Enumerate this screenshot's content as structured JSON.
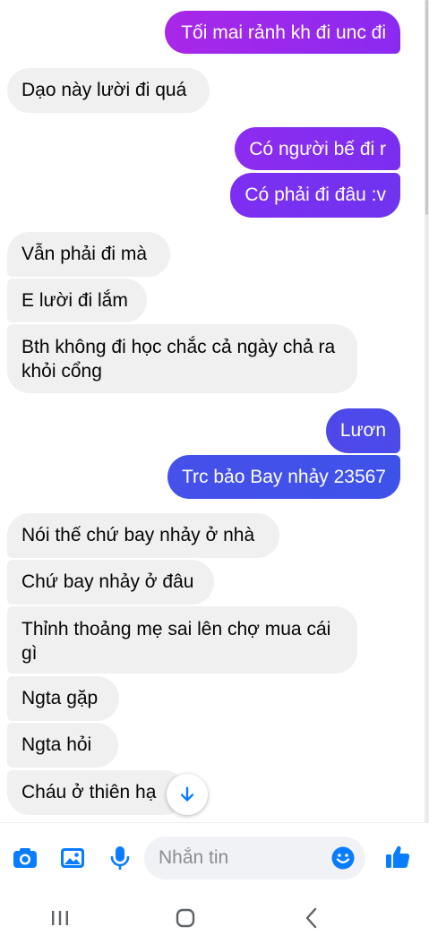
{
  "colors": {
    "accent": "#0a7cff",
    "outgoing_gradient": [
      "#8a28f0",
      "#3d50ea"
    ],
    "incoming_bg": "#f0f0f0"
  },
  "messages": [
    {
      "side": "out",
      "text": "Tối mai rảnh kh đi unc đi"
    },
    {
      "side": "in",
      "text": "Dạo này lười đi quá"
    },
    {
      "side": "out",
      "text": "Có người bế đi r"
    },
    {
      "side": "out",
      "text": "Có phải đi đâu :v"
    },
    {
      "side": "in",
      "text": "Vẫn phải đi mà"
    },
    {
      "side": "in",
      "text": "E lười đi lắm"
    },
    {
      "side": "in",
      "text": "Bth không đi học chắc cả ngày chả ra khỏi cổng"
    },
    {
      "side": "out",
      "text": "Lươn"
    },
    {
      "side": "out",
      "text": "Trc bảo Bay nhảy 23567"
    },
    {
      "side": "in",
      "text": "Nói thế chứ bay nhảy ở nhà"
    },
    {
      "side": "in",
      "text": "Chứ bay nhảy ở đâu"
    },
    {
      "side": "in",
      "text": "Thỉnh thoảng mẹ sai lên chợ mua cái gì"
    },
    {
      "side": "in",
      "text": "Ngta gặp"
    },
    {
      "side": "in",
      "text": "Ngta hỏi"
    },
    {
      "side": "in",
      "text": "Cháu ở thiên hạ"
    }
  ],
  "composer": {
    "placeholder": "Nhắn tin",
    "icons": [
      "camera-icon",
      "image-icon",
      "microphone-icon",
      "emoji-icon",
      "like-icon"
    ]
  },
  "scroll_down_icon": "arrow-down-icon",
  "system_nav": {
    "icons": [
      "recent-apps-icon",
      "home-icon",
      "back-icon"
    ]
  }
}
